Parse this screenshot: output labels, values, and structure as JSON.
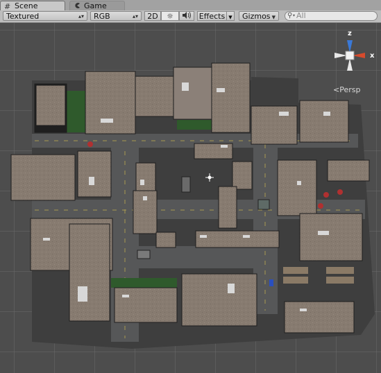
{
  "tabs": [
    {
      "label": "Scene",
      "icon": "grid-icon",
      "active": true
    },
    {
      "label": "Game",
      "icon": "pacman-icon",
      "active": false
    }
  ],
  "toolbar": {
    "shading_mode": "Textured",
    "render_mode": "RGB",
    "mode_2d": "2D",
    "lighting_icon": "sun-icon",
    "audio_icon": "speaker-icon",
    "effects_label": "Effects",
    "gizmos_label": "Gizmos",
    "search_placeholder": "All"
  },
  "gizmo": {
    "axis_y": "z",
    "axis_x": "x",
    "projection_label": "Persp"
  },
  "colors": {
    "tab_bg": "#a2a2a2",
    "toolbar_bg": "#bdbdbd",
    "scene_bg": "#4d4d4d",
    "gizmo_x": "#d64a2c",
    "gizmo_z": "#3a79d8"
  }
}
